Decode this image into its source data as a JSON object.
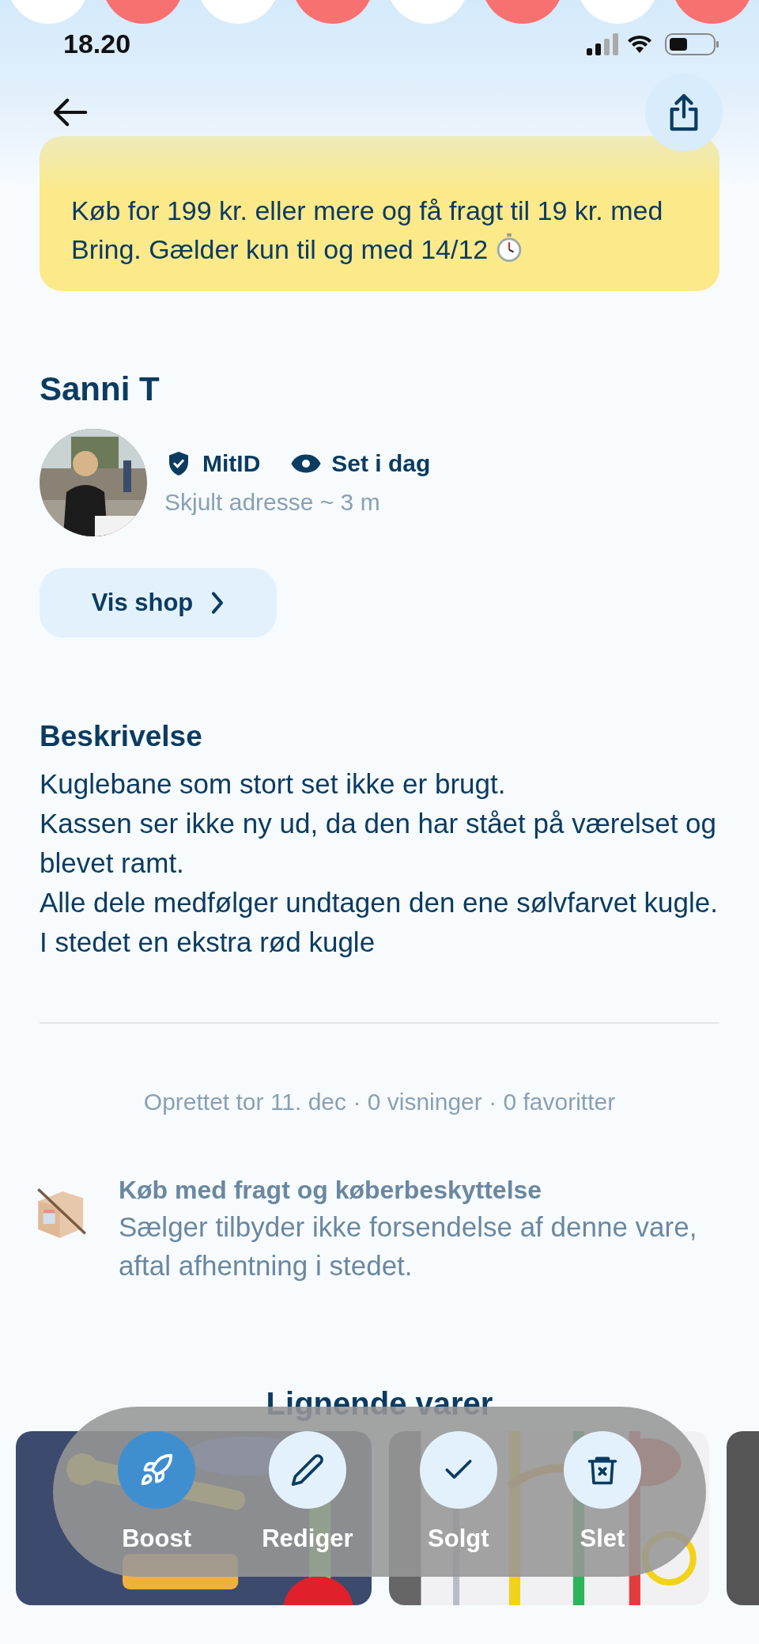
{
  "status_bar": {
    "time": "18.20"
  },
  "banner": {
    "text": "Køb for 199 kr. eller mere og få fragt til 19 kr. med Bring. Gælder kun til og med 14/12"
  },
  "seller": {
    "name": "Sanni T",
    "badges": [
      {
        "kind": "verified",
        "label": "MitID"
      },
      {
        "kind": "seen",
        "label": "Set i dag"
      }
    ],
    "location": "Skjult adresse ~ 3 m",
    "shop_button": "Vis shop"
  },
  "description": {
    "heading": "Beskrivelse",
    "lines": [
      "Kuglebane som stort set ikke er brugt.",
      "Kassen ser ikke ny ud, da den har stået på værelset og blevet ramt.",
      "Alle dele medfølger undtagen den ene sølvfarvet kugle. I stedet en ekstra rød kugle"
    ]
  },
  "meta": "Oprettet tor 11. dec · 0 visninger · 0 favoritter",
  "shipping": {
    "title": "Køb med fragt og køberbeskyttelse",
    "text": "Sælger tilbyder ikke forsendelse af denne vare, aftal afhentning i stedet."
  },
  "similar": {
    "heading": "Lignende varer"
  },
  "actions": [
    {
      "kind": "boost",
      "label": "Boost",
      "primary": true
    },
    {
      "kind": "edit",
      "label": "Rediger",
      "primary": false
    },
    {
      "kind": "sold",
      "label": "Solgt",
      "primary": false
    },
    {
      "kind": "delete",
      "label": "Slet",
      "primary": false
    }
  ]
}
